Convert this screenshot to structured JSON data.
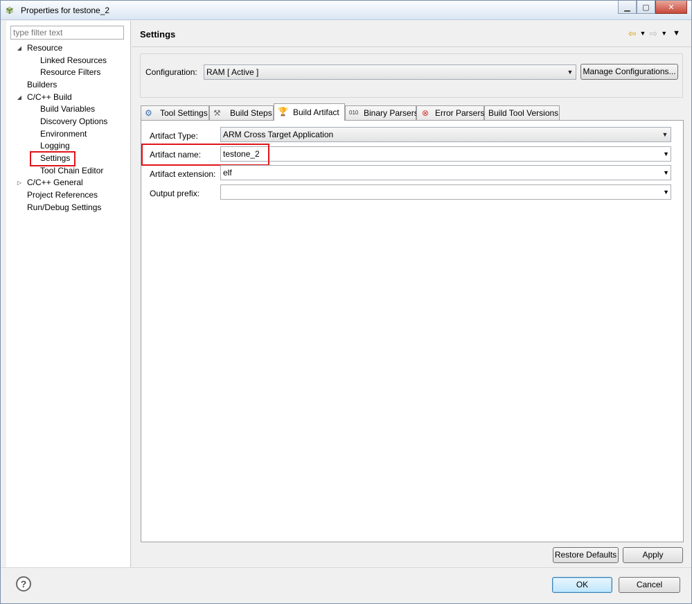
{
  "window": {
    "title": "Properties for testone_2"
  },
  "left": {
    "filter_placeholder": "type filter text",
    "tree": [
      {
        "label": "Resource",
        "expanded": true
      },
      {
        "label": "Linked Resources"
      },
      {
        "label": "Resource Filters"
      },
      {
        "label": "Builders"
      },
      {
        "label": "C/C++ Build",
        "expanded": true
      },
      {
        "label": "Build Variables"
      },
      {
        "label": "Discovery Options"
      },
      {
        "label": "Environment"
      },
      {
        "label": "Logging"
      },
      {
        "label": "Settings",
        "selected": true
      },
      {
        "label": "Tool Chain Editor"
      },
      {
        "label": "C/C++ General",
        "expanded": false
      },
      {
        "label": "Project References"
      },
      {
        "label": "Run/Debug Settings"
      }
    ]
  },
  "main": {
    "title": "Settings",
    "configuration": {
      "label": "Configuration:",
      "value": "RAM  [ Active ]",
      "manage_button": "Manage Configurations..."
    },
    "tabs": [
      {
        "label": "Tool Settings",
        "icon": "gear-icon"
      },
      {
        "label": "Build Steps",
        "icon": "hammer-icon"
      },
      {
        "label": "Build Artifact",
        "icon": "trophy-icon",
        "active": true
      },
      {
        "label": "Binary Parsers",
        "icon": "binary-icon"
      },
      {
        "label": "Error Parsers",
        "icon": "error-icon"
      },
      {
        "label": "Build Tool Versions"
      }
    ],
    "fields": {
      "artifact_type_label": "Artifact Type:",
      "artifact_type_value": "ARM Cross Target Application",
      "artifact_name_label": "Artifact name:",
      "artifact_name_value": "testone_2",
      "artifact_ext_label": "Artifact extension:",
      "artifact_ext_value": "elf",
      "output_prefix_label": "Output prefix:",
      "output_prefix_value": ""
    },
    "restore_defaults": "Restore Defaults",
    "apply": "Apply"
  },
  "footer": {
    "ok": "OK",
    "cancel": "Cancel"
  },
  "colors": {
    "highlight": "#e0141a",
    "default_button_border": "#3c7fb1"
  }
}
